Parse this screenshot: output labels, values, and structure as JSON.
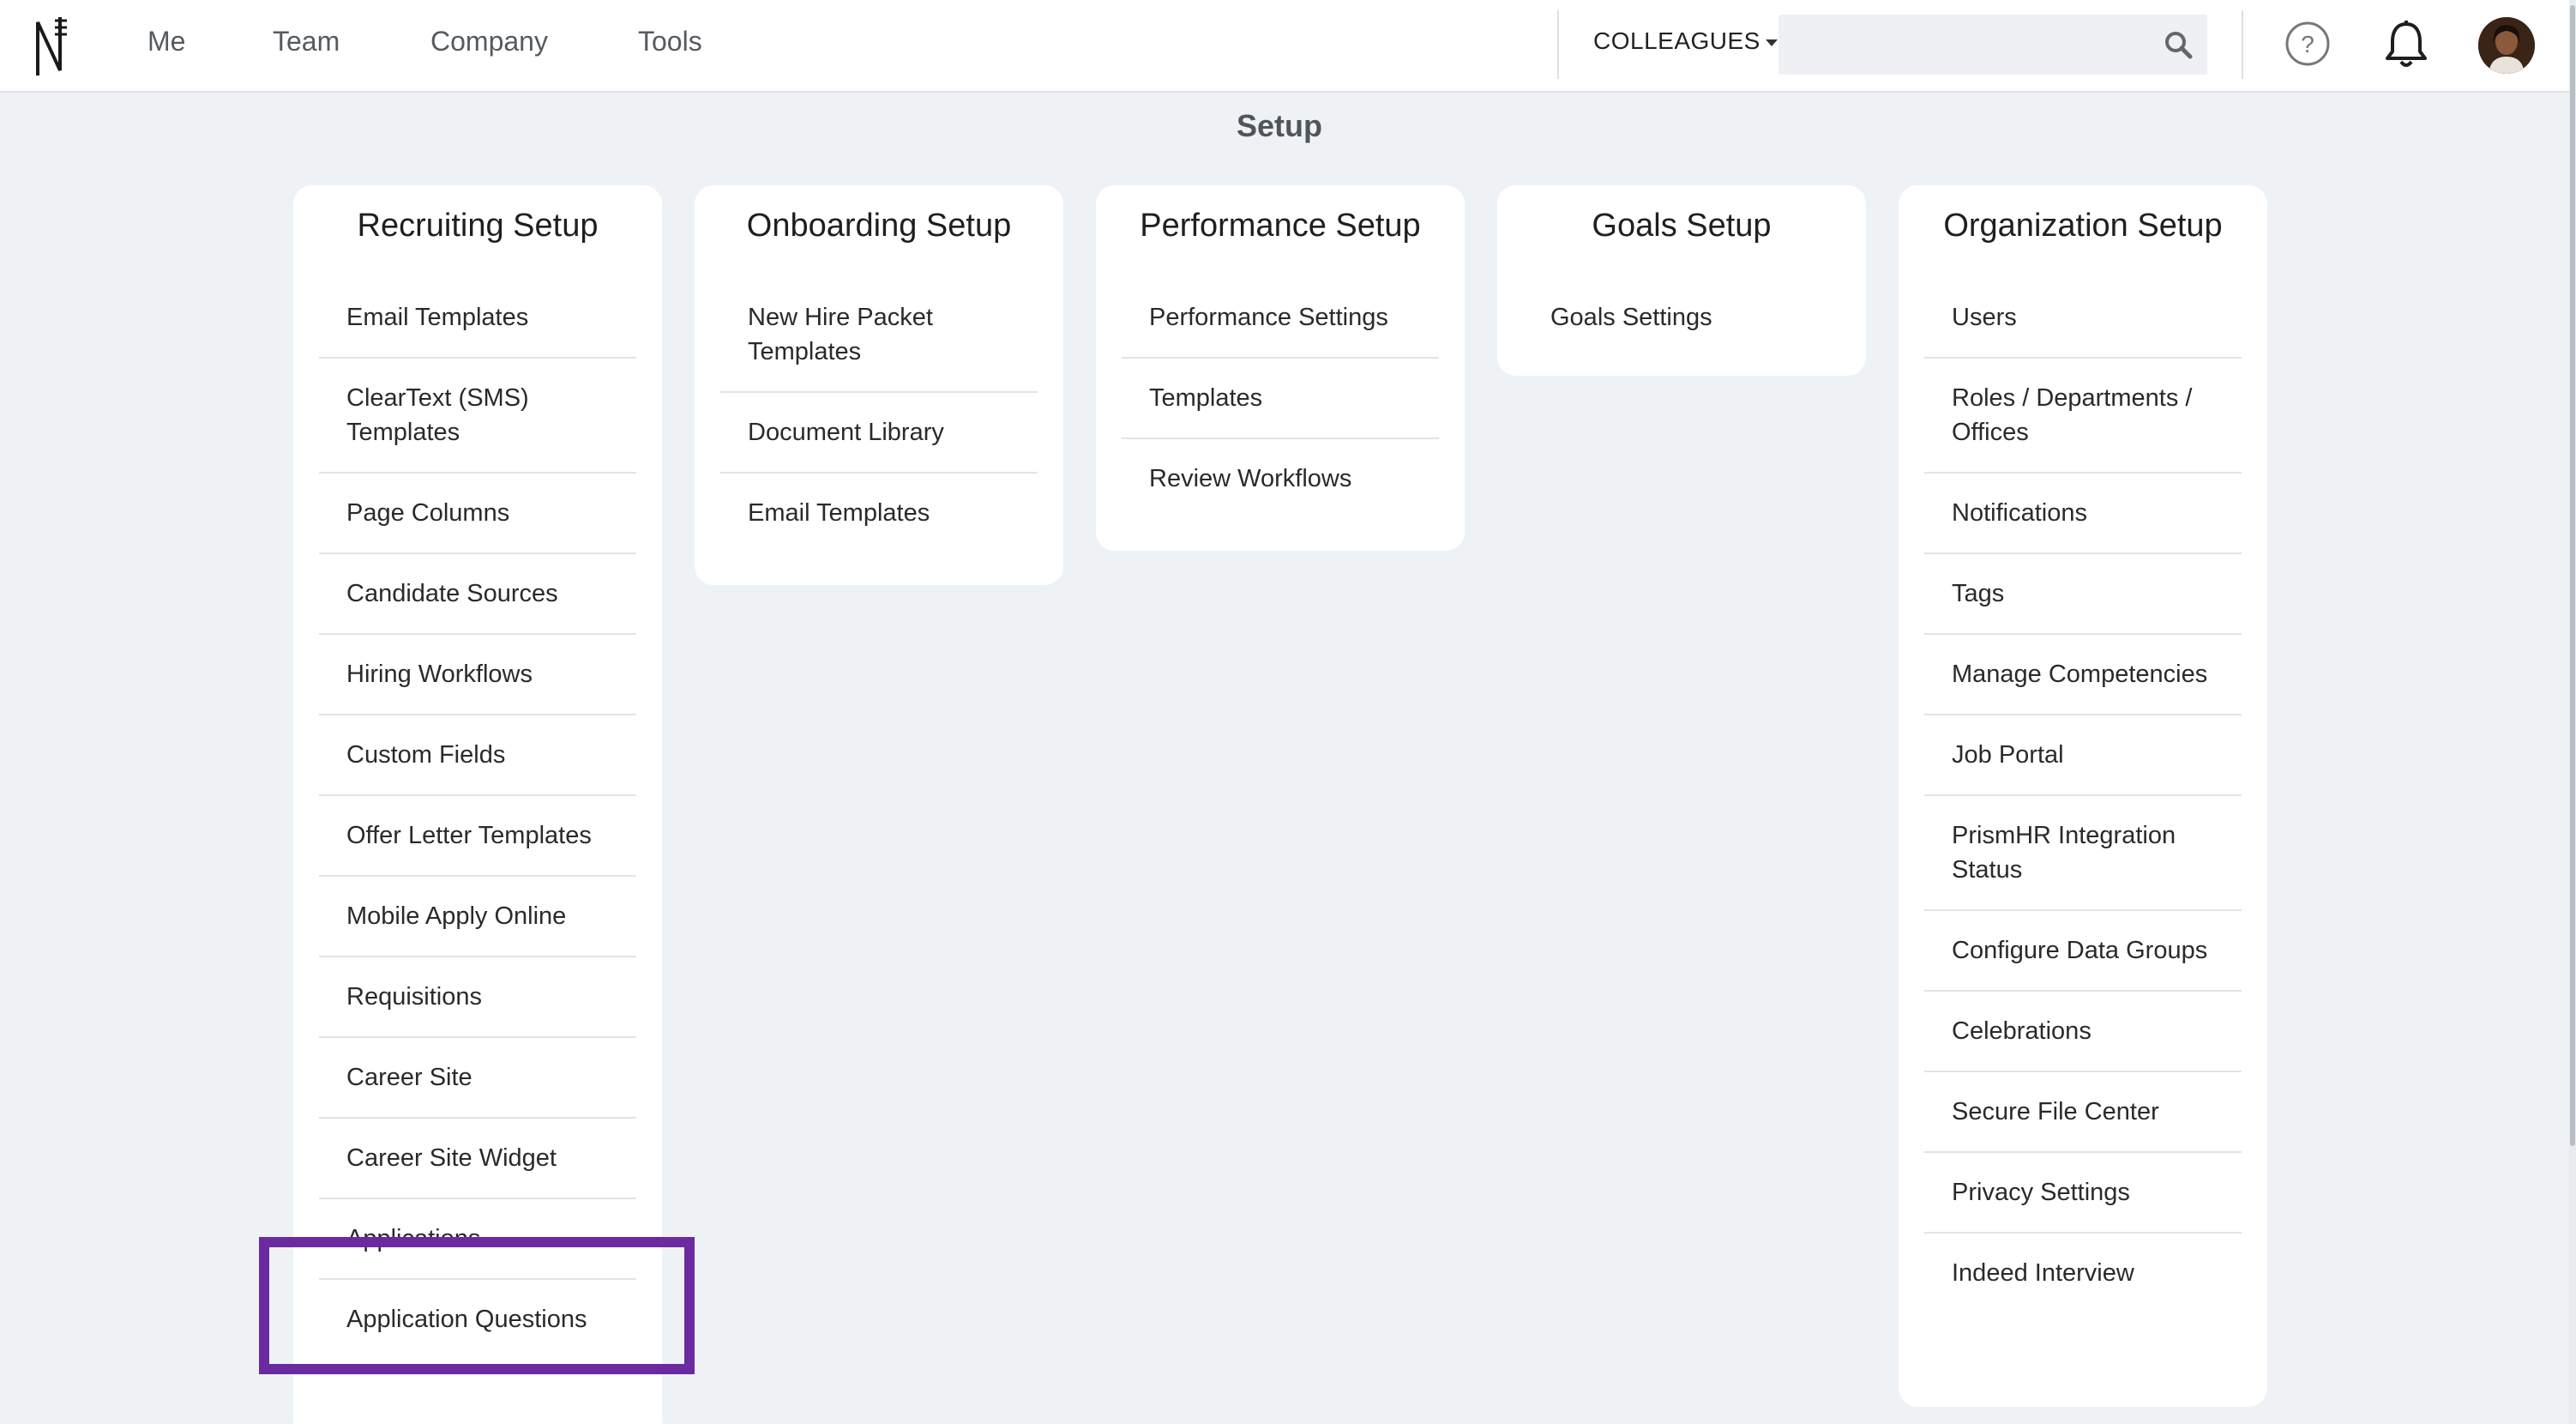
{
  "nav": {
    "links": [
      "Me",
      "Team",
      "Company",
      "Tools"
    ],
    "colleagues_label": "COLLEAGUES",
    "search_placeholder": ""
  },
  "page": {
    "title": "Setup"
  },
  "cards": [
    {
      "title": "Recruiting Setup",
      "items": [
        "Email Templates",
        "ClearText (SMS) Templates",
        "Page Columns",
        "Candidate Sources",
        "Hiring Workflows",
        "Custom Fields",
        "Offer Letter Templates",
        "Mobile Apply Online",
        "Requisitions",
        "Career Site",
        "Career Site Widget",
        "Applications",
        "Application Questions"
      ]
    },
    {
      "title": "Onboarding Setup",
      "items": [
        "New Hire Packet Templates",
        "Document Library",
        "Email Templates"
      ]
    },
    {
      "title": "Performance Setup",
      "items": [
        "Performance Settings",
        "Templates",
        "Review Workflows"
      ]
    },
    {
      "title": "Goals Setup",
      "items": [
        "Goals Settings"
      ]
    },
    {
      "title": "Organization Setup",
      "items": [
        "Users",
        "Roles / Departments / Offices",
        "Notifications",
        "Tags",
        "Manage Competencies",
        "Job Portal",
        "PrismHR Integration Status",
        "Configure Data Groups",
        "Celebrations",
        "Secure File Center",
        "Privacy Settings",
        "Indeed Interview"
      ]
    }
  ],
  "highlight_color": "#6b2aa0",
  "icons": [
    "logo-icon",
    "search-icon",
    "help-icon",
    "bell-icon",
    "avatar"
  ]
}
